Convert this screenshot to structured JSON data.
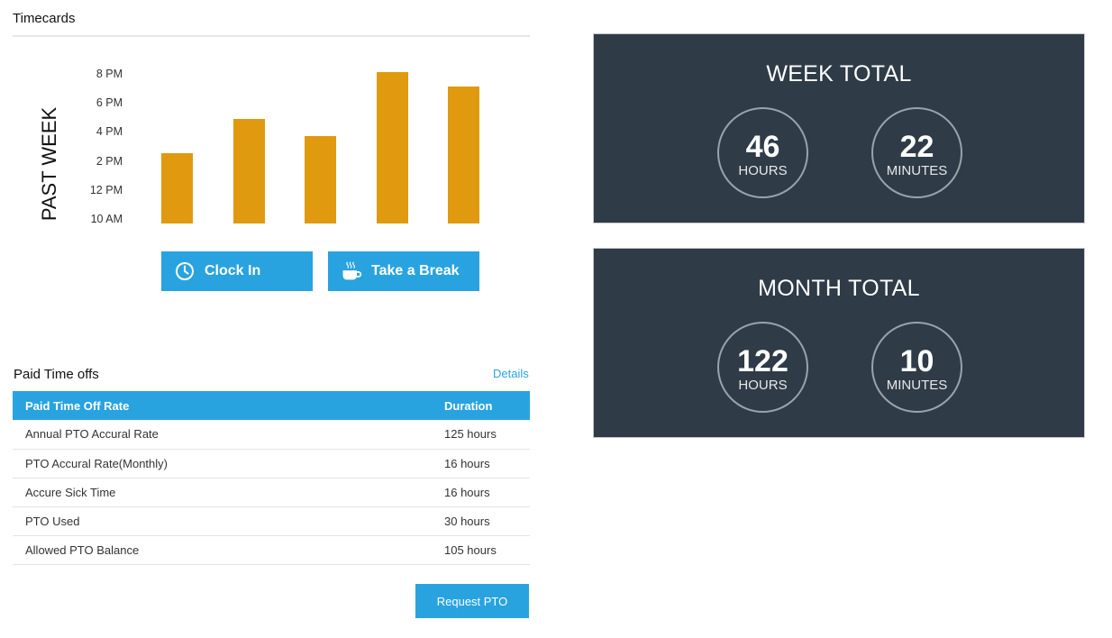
{
  "timecards": {
    "title": "Timecards",
    "axis_label": "PAST WEEK",
    "chart_data": {
      "type": "bar",
      "ylabel": "PAST WEEK",
      "y_ticks": [
        "10 AM",
        "12 PM",
        "2 PM",
        "4 PM",
        "6 PM",
        "8 PM"
      ],
      "ylim": [
        10,
        20
      ],
      "categories": [
        "",
        "",
        "",
        "",
        ""
      ],
      "values": [
        14.4,
        16.8,
        15.6,
        20.0,
        19.0
      ],
      "color": "#e09a10"
    },
    "clock_in_label": "Clock In",
    "break_label": "Take a Break"
  },
  "pto": {
    "title": "Paid Time offs",
    "details_label": "Details",
    "headers": [
      "Paid Time Off Rate",
      "Duration"
    ],
    "rows": [
      [
        "Annual PTO Accural Rate",
        "125 hours"
      ],
      [
        "PTO Accural Rate(Monthly)",
        "16 hours"
      ],
      [
        "Accure Sick Time",
        "16 hours"
      ],
      [
        "PTO Used",
        "30 hours"
      ],
      [
        "Allowed PTO Balance",
        "105 hours"
      ]
    ],
    "request_label": "Request PTO"
  },
  "week_total": {
    "title": "WEEK TOTAL",
    "hours": "46",
    "hours_label": "HOURS",
    "minutes": "22",
    "minutes_label": "MINUTES"
  },
  "month_total": {
    "title": "MONTH TOTAL",
    "hours": "122",
    "hours_label": "HOURS",
    "minutes": "10",
    "minutes_label": "MINUTES"
  },
  "colors": {
    "accent": "#29a3e0",
    "bar": "#e09a10",
    "panel": "#2f3b47"
  },
  "icons": {
    "clock_in": "clock-icon",
    "break": "coffee-cup-icon"
  }
}
